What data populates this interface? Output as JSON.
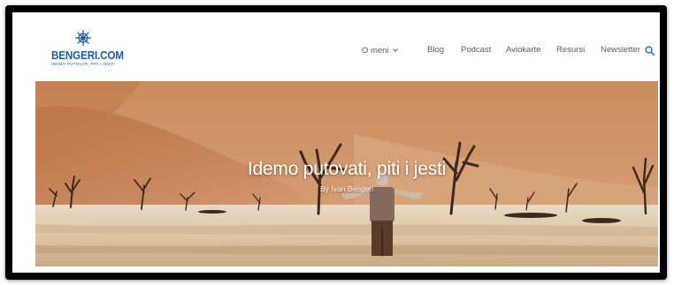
{
  "site": {
    "logo_title": "BENGERI.COM",
    "logo_tagline": "IDEMO PUTOVATI, PITI I JESTI",
    "logo_icon": "ship-wheel-icon",
    "brand_color": "#1f5ea8"
  },
  "nav": {
    "items": [
      {
        "label": "O meni",
        "has_dropdown": true
      },
      {
        "label": "Blog"
      },
      {
        "label": "Podcast"
      },
      {
        "label": "Aviokarte"
      },
      {
        "label": "Resursi"
      },
      {
        "label": "Newsletter"
      }
    ],
    "dropdown_icon": "chevron-down-icon",
    "search_icon": "search-icon",
    "text_color": "#555a60",
    "accent_color": "#2f7fc1"
  },
  "hero": {
    "title": "Idemo putovati, piti i jesti",
    "byline": "By Ivan Bengeri",
    "image": "desert-dead-trees-photo"
  }
}
